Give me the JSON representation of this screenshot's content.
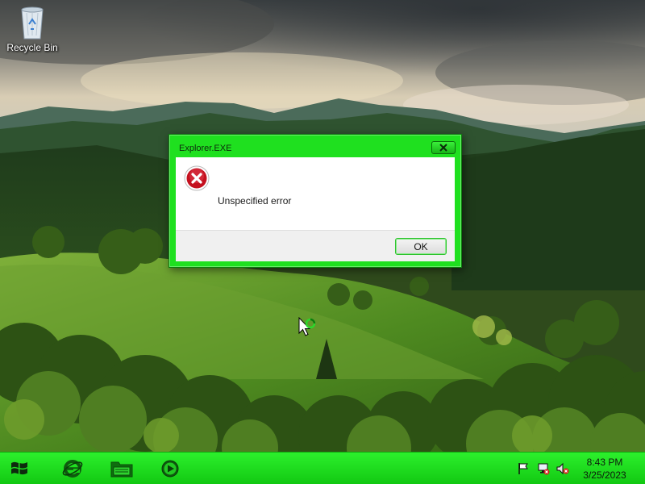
{
  "desktop": {
    "icons": [
      {
        "label": "Recycle Bin",
        "icon": "recycle-bin-icon"
      }
    ]
  },
  "dialog": {
    "title": "Explorer.EXE",
    "message": "Unspecified error",
    "ok_label": "OK",
    "icon": "error-icon",
    "close_icon": "close-icon"
  },
  "taskbar": {
    "start_icon": "windows-logo-icon",
    "pinned": [
      {
        "name": "Internet Explorer",
        "icon": "internet-explorer-icon"
      },
      {
        "name": "Windows Explorer",
        "icon": "folder-icon"
      },
      {
        "name": "Media Player",
        "icon": "media-player-icon"
      }
    ],
    "tray": {
      "icons": [
        "action-center-flag-icon",
        "network-icon",
        "volume-muted-icon"
      ],
      "time": "8:43 PM",
      "date": "3/25/2023"
    }
  },
  "colors": {
    "accent": "#1fe01f",
    "taskbar": "#16d416",
    "error_red": "#c4101e"
  }
}
